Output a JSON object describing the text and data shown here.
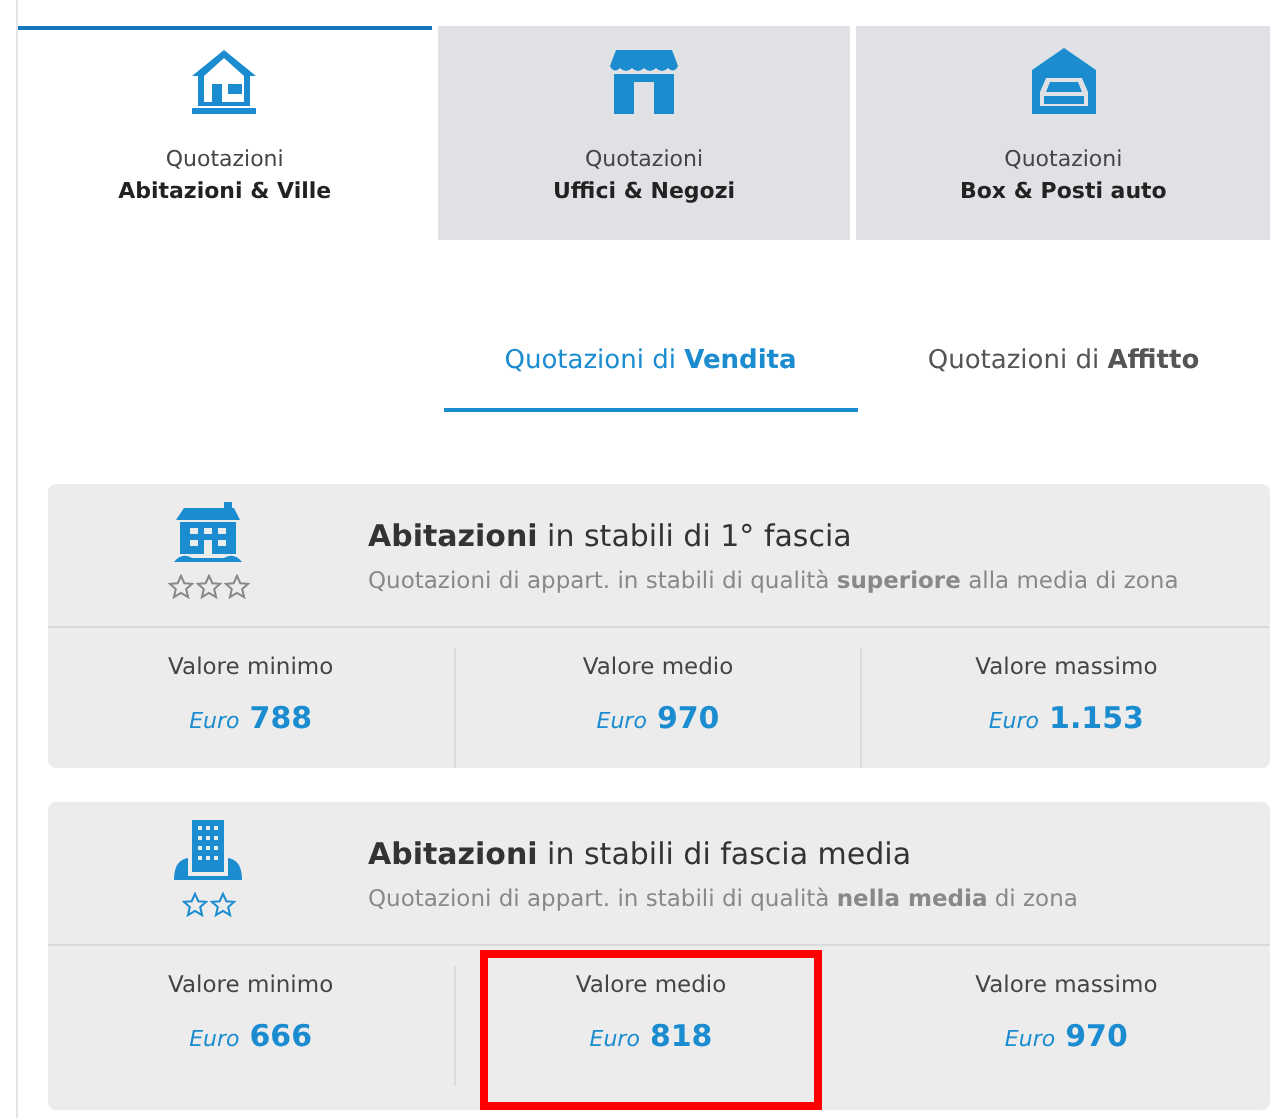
{
  "category_tabs": [
    {
      "kind": "house",
      "line1": "Quotazioni",
      "line2": "Abitazioni & Ville",
      "selected": true
    },
    {
      "kind": "shop",
      "line1": "Quotazioni",
      "line2": "Uffici & Negozi",
      "selected": false
    },
    {
      "kind": "garage",
      "line1": "Quotazioni",
      "line2": "Box & Posti auto",
      "selected": false
    }
  ],
  "mode_tabs": [
    {
      "label": "Quotazioni di **Vendita**",
      "selected": true
    },
    {
      "label": "Quotazioni di **Affitto**",
      "selected": false
    }
  ],
  "cards": [
    {
      "kind": "superior",
      "title": "**Abitazioni** in stabili di 1° fascia",
      "subtitle": "Quotazioni di appart. in stabili di qualità **superiore** alla media di zona",
      "values": [
        {
          "label": "Valore minimo",
          "currency": "Euro",
          "amount": "788",
          "highlighted": false
        },
        {
          "label": "Valore medio",
          "currency": "Euro",
          "amount": "970",
          "highlighted": false
        },
        {
          "label": "Valore massimo",
          "currency": "Euro",
          "amount": "1.153",
          "highlighted": false
        }
      ]
    },
    {
      "kind": "average",
      "title": "**Abitazioni** in stabili di fascia media",
      "subtitle": "Quotazioni di appart. in stabili di qualità **nella media** di zona",
      "values": [
        {
          "label": "Valore minimo",
          "currency": "Euro",
          "amount": "666",
          "highlighted": false
        },
        {
          "label": "Valore medio",
          "currency": "Euro",
          "amount": "818",
          "highlighted": true
        },
        {
          "label": "Valore massimo",
          "currency": "Euro",
          "amount": "970",
          "highlighted": false
        }
      ]
    }
  ]
}
